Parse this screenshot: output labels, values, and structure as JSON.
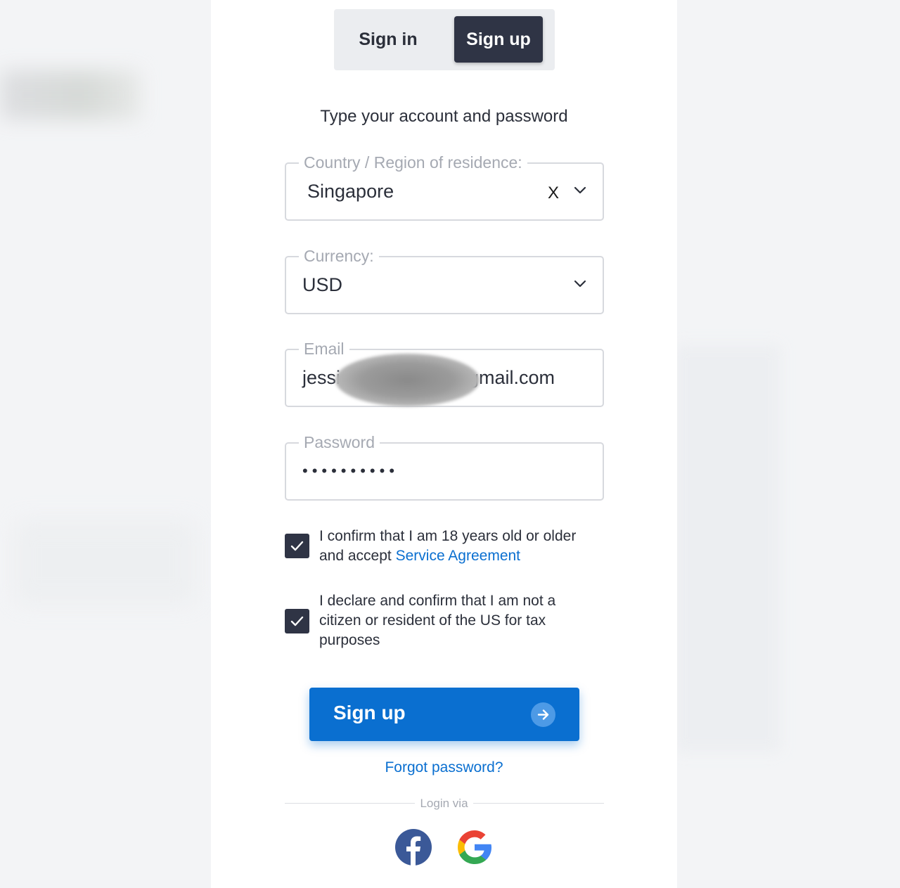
{
  "tabs": {
    "signin_label": "Sign in",
    "signup_label": "Sign up",
    "active": "Sign up"
  },
  "form": {
    "subtitle": "Type your account and password",
    "country": {
      "legend": "Country / Region of residence:",
      "value": "Singapore",
      "clear_label": "X"
    },
    "currency": {
      "legend": "Currency:",
      "value": "USD"
    },
    "email": {
      "legend": "Email",
      "value_prefix": "jessi",
      "value_suffix": "gmail.com"
    },
    "password": {
      "legend": "Password",
      "masked_value": "••••••••••"
    },
    "age_confirm": {
      "checked": true,
      "text": "I confirm that I am 18 years old or older and accept",
      "link_text": "Service Agreement"
    },
    "us_declaration": {
      "checked": true,
      "text": "I declare and confirm that I am not a citizen or resident of the US for tax purposes"
    },
    "submit_label": "Sign up",
    "forgot_label": "Forgot password?",
    "login_via_label": "Login via"
  },
  "social": [
    {
      "name": "facebook-icon",
      "color": "#3b5998"
    },
    {
      "name": "google-icon",
      "color": "#4285f4"
    }
  ],
  "colors": {
    "primary": "#0a6fd0",
    "dark": "#2f3445",
    "border": "#d7d9de"
  }
}
